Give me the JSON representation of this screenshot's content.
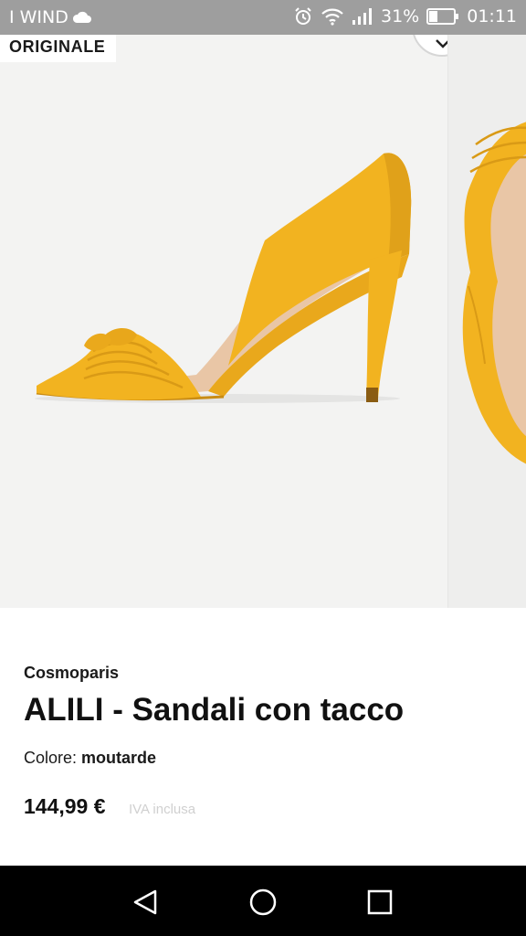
{
  "status_bar": {
    "carrier": "I WIND",
    "battery_percent": "31%",
    "time": "01:11",
    "icons": [
      "cloud-icon",
      "alarm-icon",
      "wifi-icon",
      "signal-icon",
      "battery-icon"
    ]
  },
  "gallery": {
    "badge": "ORIGINALE",
    "icons": [
      "chevron-down-icon"
    ]
  },
  "product": {
    "brand": "Cosmoparis",
    "title": "ALILI - Sandali con tacco",
    "color_label": "Colore:",
    "color_value": "moutarde",
    "price": "144,99 €",
    "vat_note": "IVA inclusa"
  },
  "nav_bar": {
    "icons": [
      "back-icon",
      "home-icon",
      "recents-icon"
    ]
  },
  "colors": {
    "status_bar": "#9e9e9e",
    "image_background": "#f3f3f2",
    "shoe_mustard": "#f2b320",
    "nav_bar": "#000000"
  }
}
